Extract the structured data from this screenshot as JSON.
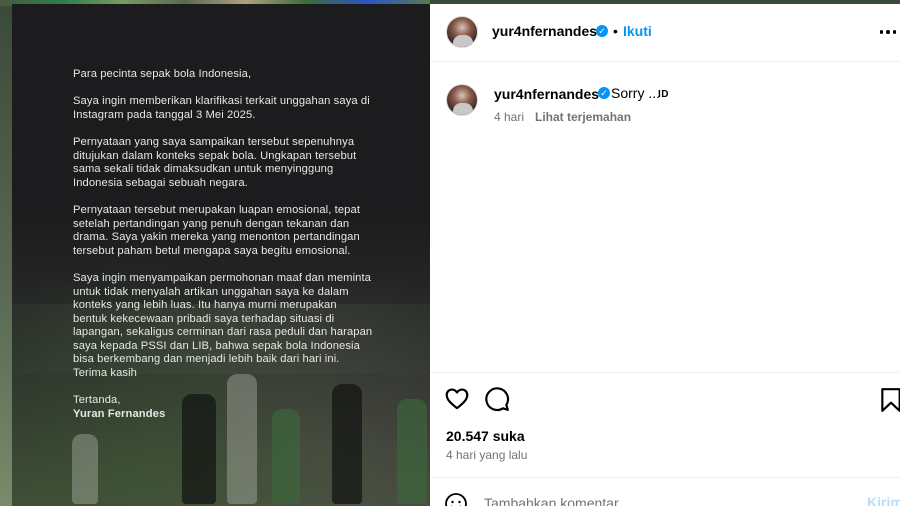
{
  "post": {
    "letter": {
      "greeting": "Para pecinta sepak bola Indonesia,",
      "paragraphs": [
        "Saya ingin memberikan klarifikasi terkait unggahan saya di Instagram pada tanggal 3 Mei 2025.",
        "Pernyataan yang saya sampaikan tersebut sepenuhnya ditujukan dalam konteks sepak bola. Ungkapan tersebut sama sekali tidak dimaksudkan untuk menyinggung Indonesia sebagai sebuah negara.",
        "Pernyataan tersebut merupakan luapan emosional, tepat setelah pertandingan yang penuh dengan tekanan dan drama. Saya yakin mereka yang menonton pertandingan tersebut paham betul mengapa saya begitu emosional.",
        "Saya ingin menyampaikan permohonan maaf dan meminta untuk tidak menyalah artikan unggahan saya ke dalam konteks yang lebih luas. Itu hanya murni merupakan bentuk kekecewaan pribadi saya terhadap situasi di lapangan, sekaligus cerminan dari rasa peduli dan harapan saya kepada PSSI dan LIB, bahwa sepak bola Indonesia bisa berkembang dan menjadi lebih baik dari hari ini. Terima kasih"
      ],
      "sign_off": "Tertanda,",
      "signer": "Yuran Fernandes"
    }
  },
  "header": {
    "username": "yur4nfernandes",
    "separator": "•",
    "follow_label": "Ikuti",
    "verified_icon": "verified-badge-icon"
  },
  "caption": {
    "username": "yur4nfernandes",
    "text": "Sorry ...",
    "lang": "ID",
    "age": "4 hari",
    "translate_label": "Lihat terjemahan"
  },
  "actions": {
    "likes": "20.547 suka",
    "time": "4 hari yang lalu"
  },
  "comment_box": {
    "placeholder": "Tambahkan komentar...",
    "send_label": "Kirim"
  },
  "colors": {
    "accent": "#0095f6",
    "muted": "#737373",
    "send_disabled": "#b3dffc"
  }
}
